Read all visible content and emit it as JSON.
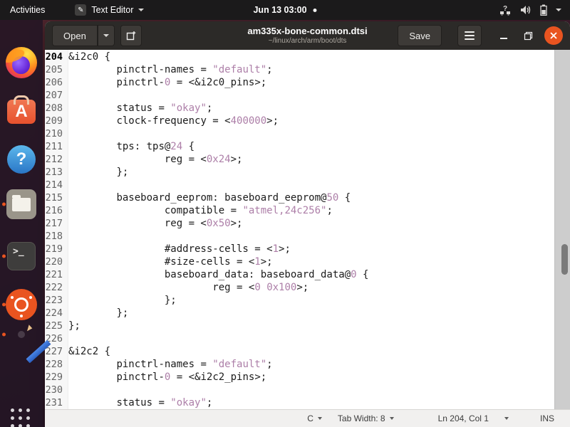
{
  "colors": {
    "accent": "#E95420",
    "string_token": "#ad7fa8"
  },
  "top_bar": {
    "activities": "Activities",
    "app_menu": {
      "icon": "pencil-icon",
      "label": "Text Editor"
    },
    "clock": "Jun 13 03:00",
    "tray_icons": [
      "network-question-icon",
      "volume-icon",
      "battery-icon",
      "chevron-down-icon"
    ]
  },
  "dock": {
    "items": [
      {
        "icon": "firefox-icon",
        "indicator": false,
        "active": false
      },
      {
        "icon": "ubuntu-software-icon",
        "indicator": false,
        "active": false
      },
      {
        "icon": "help-icon",
        "indicator": false,
        "active": false
      },
      {
        "icon": "files-icon",
        "indicator": true,
        "active": false
      },
      {
        "icon": "terminal-icon",
        "indicator": true,
        "active": false
      },
      {
        "icon": "ubuntu-icon",
        "indicator": true,
        "active": false
      },
      {
        "icon": "text-editor-icon",
        "indicator": true,
        "active": true
      },
      {
        "icon": "app-grid-icon",
        "indicator": false,
        "active": false
      }
    ],
    "terminal_glyph": ">_",
    "software_glyph": "A",
    "help_glyph": "?"
  },
  "window": {
    "header": {
      "open_label": "Open",
      "title": "am335x-bone-common.dtsi",
      "subtitle": "~/linux/arch/arm/boot/dts",
      "save_label": "Save"
    },
    "status_bar": {
      "language": "C",
      "tab_width": "Tab Width: 8",
      "position": "Ln 204, Col 1",
      "mode": "INS"
    }
  },
  "editor": {
    "lines": [
      {
        "n": 204,
        "cur": true,
        "seg": [
          [
            "&i2c0 {",
            0
          ]
        ]
      },
      {
        "n": 205,
        "seg": [
          [
            "\tpinctrl-names = ",
            0
          ],
          [
            "\"default\"",
            1
          ],
          [
            ";",
            0
          ]
        ]
      },
      {
        "n": 206,
        "seg": [
          [
            "\tpinctrl-",
            0
          ],
          [
            "0",
            1
          ],
          [
            " = <&i2c0_pins>;",
            0
          ]
        ]
      },
      {
        "n": 207,
        "seg": []
      },
      {
        "n": 208,
        "seg": [
          [
            "\tstatus = ",
            0
          ],
          [
            "\"okay\"",
            1
          ],
          [
            ";",
            0
          ]
        ]
      },
      {
        "n": 209,
        "seg": [
          [
            "\tclock-frequency = <",
            0
          ],
          [
            "400000",
            1
          ],
          [
            ">;",
            0
          ]
        ]
      },
      {
        "n": 210,
        "seg": []
      },
      {
        "n": 211,
        "seg": [
          [
            "\ttps: tps@",
            0
          ],
          [
            "24",
            1
          ],
          [
            " {",
            0
          ]
        ]
      },
      {
        "n": 212,
        "seg": [
          [
            "\t\treg = <",
            0
          ],
          [
            "0x24",
            1
          ],
          [
            ">;",
            0
          ]
        ]
      },
      {
        "n": 213,
        "seg": [
          [
            "\t};",
            0
          ]
        ]
      },
      {
        "n": 214,
        "seg": []
      },
      {
        "n": 215,
        "seg": [
          [
            "\tbaseboard_eeprom: baseboard_eeprom@",
            0
          ],
          [
            "50",
            1
          ],
          [
            " {",
            0
          ]
        ]
      },
      {
        "n": 216,
        "seg": [
          [
            "\t\tcompatible = ",
            0
          ],
          [
            "\"atmel,24c256\"",
            1
          ],
          [
            ";",
            0
          ]
        ]
      },
      {
        "n": 217,
        "seg": [
          [
            "\t\treg = <",
            0
          ],
          [
            "0x50",
            1
          ],
          [
            ">;",
            0
          ]
        ]
      },
      {
        "n": 218,
        "seg": []
      },
      {
        "n": 219,
        "seg": [
          [
            "\t\t#address-cells = <",
            0
          ],
          [
            "1",
            1
          ],
          [
            ">;",
            0
          ]
        ]
      },
      {
        "n": 220,
        "seg": [
          [
            "\t\t#size-cells = <",
            0
          ],
          [
            "1",
            1
          ],
          [
            ">;",
            0
          ]
        ]
      },
      {
        "n": 221,
        "seg": [
          [
            "\t\tbaseboard_data: baseboard_data@",
            0
          ],
          [
            "0",
            1
          ],
          [
            " {",
            0
          ]
        ]
      },
      {
        "n": 222,
        "seg": [
          [
            "\t\t\treg = <",
            0
          ],
          [
            "0",
            1
          ],
          [
            " ",
            0
          ],
          [
            "0x100",
            1
          ],
          [
            ">;",
            0
          ]
        ]
      },
      {
        "n": 223,
        "seg": [
          [
            "\t\t};",
            0
          ]
        ]
      },
      {
        "n": 224,
        "seg": [
          [
            "\t};",
            0
          ]
        ]
      },
      {
        "n": 225,
        "seg": [
          [
            "};",
            0
          ]
        ]
      },
      {
        "n": 226,
        "seg": []
      },
      {
        "n": 227,
        "seg": [
          [
            "&i2c2 {",
            0
          ]
        ]
      },
      {
        "n": 228,
        "seg": [
          [
            "\tpinctrl-names = ",
            0
          ],
          [
            "\"default\"",
            1
          ],
          [
            ";",
            0
          ]
        ]
      },
      {
        "n": 229,
        "seg": [
          [
            "\tpinctrl-",
            0
          ],
          [
            "0",
            1
          ],
          [
            " = <&i2c2_pins>;",
            0
          ]
        ]
      },
      {
        "n": 230,
        "seg": []
      },
      {
        "n": 231,
        "seg": [
          [
            "\tstatus = ",
            0
          ],
          [
            "\"okay\"",
            1
          ],
          [
            ";",
            0
          ]
        ]
      }
    ]
  }
}
